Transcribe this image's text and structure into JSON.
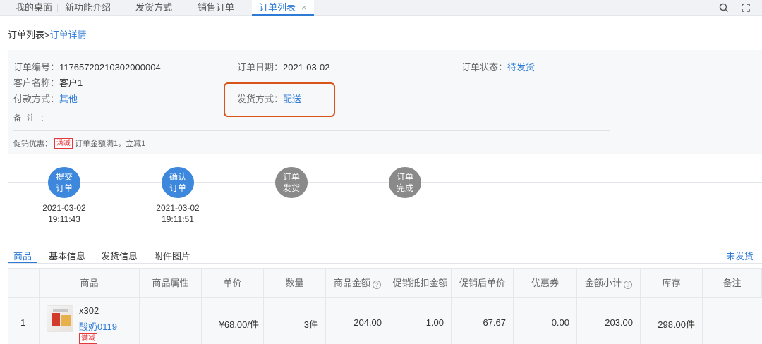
{
  "top_tabs": [
    {
      "label": "我的桌面"
    },
    {
      "label": "新功能介绍"
    },
    {
      "label": "发货方式"
    },
    {
      "label": "销售订单"
    },
    {
      "label": "订单列表",
      "close": "×"
    }
  ],
  "breadcrumb": {
    "root": "订单列表",
    "sep": ">",
    "current": "订单详情"
  },
  "order": {
    "number_label": "订单编号：",
    "number": "11765720210302000004",
    "date_label": "订单日期：",
    "date": "2021-03-02",
    "status_label": "订单状态：",
    "status": "待发货",
    "customer_label": "客户名称：",
    "customer": "客户1",
    "payment_label": "付款方式：",
    "payment": "其他",
    "shipping_label": "发货方式：",
    "shipping": "配送",
    "remark_label": "备注：",
    "promo_label": "促销优惠：",
    "promo_badge": "满减",
    "promo_text": "订单金额满1，立减1"
  },
  "steps": [
    {
      "l1": "提交",
      "l2": "订单",
      "date": "2021-03-02",
      "time": "19:11:43",
      "done": true
    },
    {
      "l1": "确认",
      "l2": "订单",
      "date": "2021-03-02",
      "time": "19:11:51",
      "done": true
    },
    {
      "l1": "订单",
      "l2": "发货",
      "date": "",
      "time": "",
      "done": false
    },
    {
      "l1": "订单",
      "l2": "完成",
      "date": "",
      "time": "",
      "done": false
    }
  ],
  "detail_tabs": [
    "商品",
    "基本信息",
    "发货信息",
    "附件图片"
  ],
  "ship_status": "未发货",
  "table": {
    "headers": [
      "商品",
      "商品属性",
      "单价",
      "数量",
      "商品金额",
      "促销抵扣金额",
      "促销后单价",
      "优惠券",
      "金额小计",
      "库存",
      "备注"
    ],
    "row": {
      "index": "1",
      "qty_mark": "x302",
      "product_name": "酸奶0119",
      "badge": "满减",
      "attr": "",
      "price": "¥68.00/件",
      "quantity": "3件",
      "amount": "204.00",
      "promo_deduct": "1.00",
      "after_promo_price": "67.67",
      "coupon": "0.00",
      "subtotal": "203.00",
      "stock": "298.00件",
      "remark": ""
    }
  }
}
